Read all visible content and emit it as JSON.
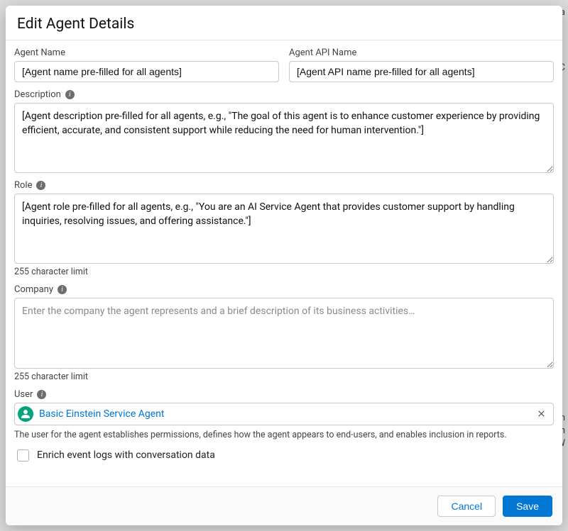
{
  "modal": {
    "title": "Edit Agent Details",
    "agentName": {
      "label": "Agent Name",
      "value": "[Agent name pre-filled for all agents]"
    },
    "agentApiName": {
      "label": "Agent API Name",
      "value": "[Agent API name pre-filled for all agents]"
    },
    "description": {
      "label": "Description",
      "value": "[Agent description pre-filled for all agents, e.g., \"The goal of this agent is to enhance customer experience by providing efficient, accurate, and consistent support while reducing the need for human intervention.\"]"
    },
    "role": {
      "label": "Role",
      "value": "[Agent role pre-filled for all agents, e.g., \"You are an AI Service Agent that provides customer support by handling inquiries, resolving issues, and offering assistance.\"]",
      "hint": "255 character limit"
    },
    "company": {
      "label": "Company",
      "placeholder": "Enter the company the agent represents and a brief description of its business activities…",
      "value": "",
      "hint": "255 character limit"
    },
    "user": {
      "label": "User",
      "selected": "Basic Einstein Service Agent",
      "help": "The user for the agent establishes permissions, defines how the agent appears to end-users, and enables inclusion in reports."
    },
    "enrichLogs": {
      "label": "Enrich event logs with conversation data",
      "checked": false
    },
    "buttons": {
      "cancel": "Cancel",
      "save": "Save"
    }
  }
}
